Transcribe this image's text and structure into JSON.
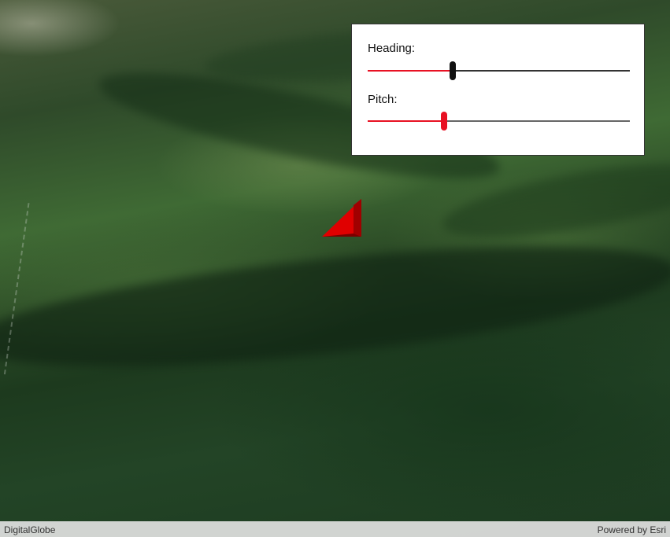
{
  "controls": {
    "heading": {
      "label": "Heading:",
      "value_fraction": 0.325
    },
    "pitch": {
      "label": "Pitch:",
      "value_fraction": 0.29
    }
  },
  "scene": {
    "model_icon": "red-triangle-icon",
    "model_color": "#e00000"
  },
  "attribution": {
    "source": "DigitalGlobe",
    "powered_by": "Powered by Esri"
  },
  "colors": {
    "accent": "#e81123",
    "thumb_heading": "#111111",
    "thumb_pitch": "#e81123"
  }
}
